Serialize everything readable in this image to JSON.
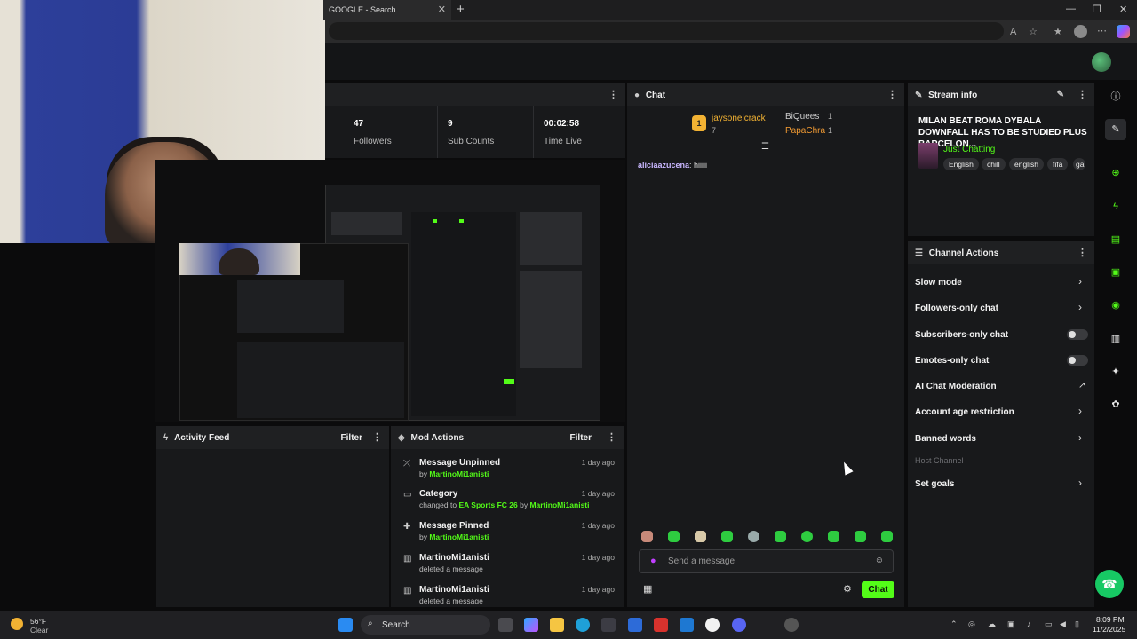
{
  "browser": {
    "tab_title": "GOOGLE - Search",
    "tab_close": "✕",
    "new_tab": "+",
    "win_min": "—",
    "win_max": "❐",
    "win_close": "✕"
  },
  "stats": {
    "followers_num": "47",
    "followers_label": "Followers",
    "subs_num": "9",
    "subs_label": "Sub Counts",
    "time_num": "00:02:58",
    "time_label": "Time Live"
  },
  "chat": {
    "title": "Chat",
    "leader1_name": "jaysonelcrack",
    "leader1_count": "7",
    "leader2_name": "BiQuees",
    "leader2_count": "1",
    "leader3_name": "PapaChra",
    "leader3_count": "1",
    "message_user": "aliciaazucena",
    "message_text": ": hiiiii",
    "input_placeholder": "Send a message",
    "send_label": "Chat"
  },
  "stream_info": {
    "title": "Stream info",
    "stream_title": "MILAN BEAT ROMA DYBALA DOWNFALL HAS TO BE STUDIED PLUS BARCELON...",
    "category": "Just Chatting",
    "tags": [
      "English",
      "chill",
      "english",
      "fifa",
      "ga"
    ]
  },
  "channel_actions": {
    "title": "Channel Actions",
    "items": [
      "Slow mode",
      "Followers-only chat",
      "Subscribers-only chat",
      "Emotes-only chat",
      "AI Chat Moderation",
      "Account age restriction",
      "Banned words",
      "Host Channel",
      "Set goals"
    ]
  },
  "activity_feed": {
    "title": "Activity Feed",
    "filter": "Filter"
  },
  "mod_actions": {
    "title": "Mod Actions",
    "filter": "Filter",
    "items": [
      {
        "title": "Message Unpinned",
        "pre": "by ",
        "user": "MartinoMi1anisti",
        "mid": "",
        "target": "",
        "time": "1 day ago"
      },
      {
        "title": "Category",
        "pre": "changed to ",
        "user": "EA Sports FC 26",
        "mid": " by ",
        "target": "MartinoMi1anisti",
        "time": "1 day ago"
      },
      {
        "title": "Message Pinned",
        "pre": "by ",
        "user": "MartinoMi1anisti",
        "mid": "",
        "target": "",
        "time": "1 day ago"
      },
      {
        "title": "MartinoMi1anisti",
        "pre": "deleted a message",
        "user": "",
        "mid": "",
        "target": "",
        "time": "1 day ago"
      },
      {
        "title": "MartinoMi1anisti",
        "pre": "deleted a message",
        "user": "",
        "mid": "",
        "target": "",
        "time": "1 day ago"
      }
    ]
  },
  "taskbar": {
    "temp": "56°F",
    "condition": "Clear",
    "search": "Search",
    "time": "8:09 PM",
    "date": "11/2/2025"
  },
  "colors": {
    "accent": "#53fc18",
    "panel": "#18191b",
    "background": "#0b0b0c"
  },
  "icons": {
    "kebab": "⋮",
    "chevron": "›",
    "pencil": "✎",
    "help": "☎"
  }
}
